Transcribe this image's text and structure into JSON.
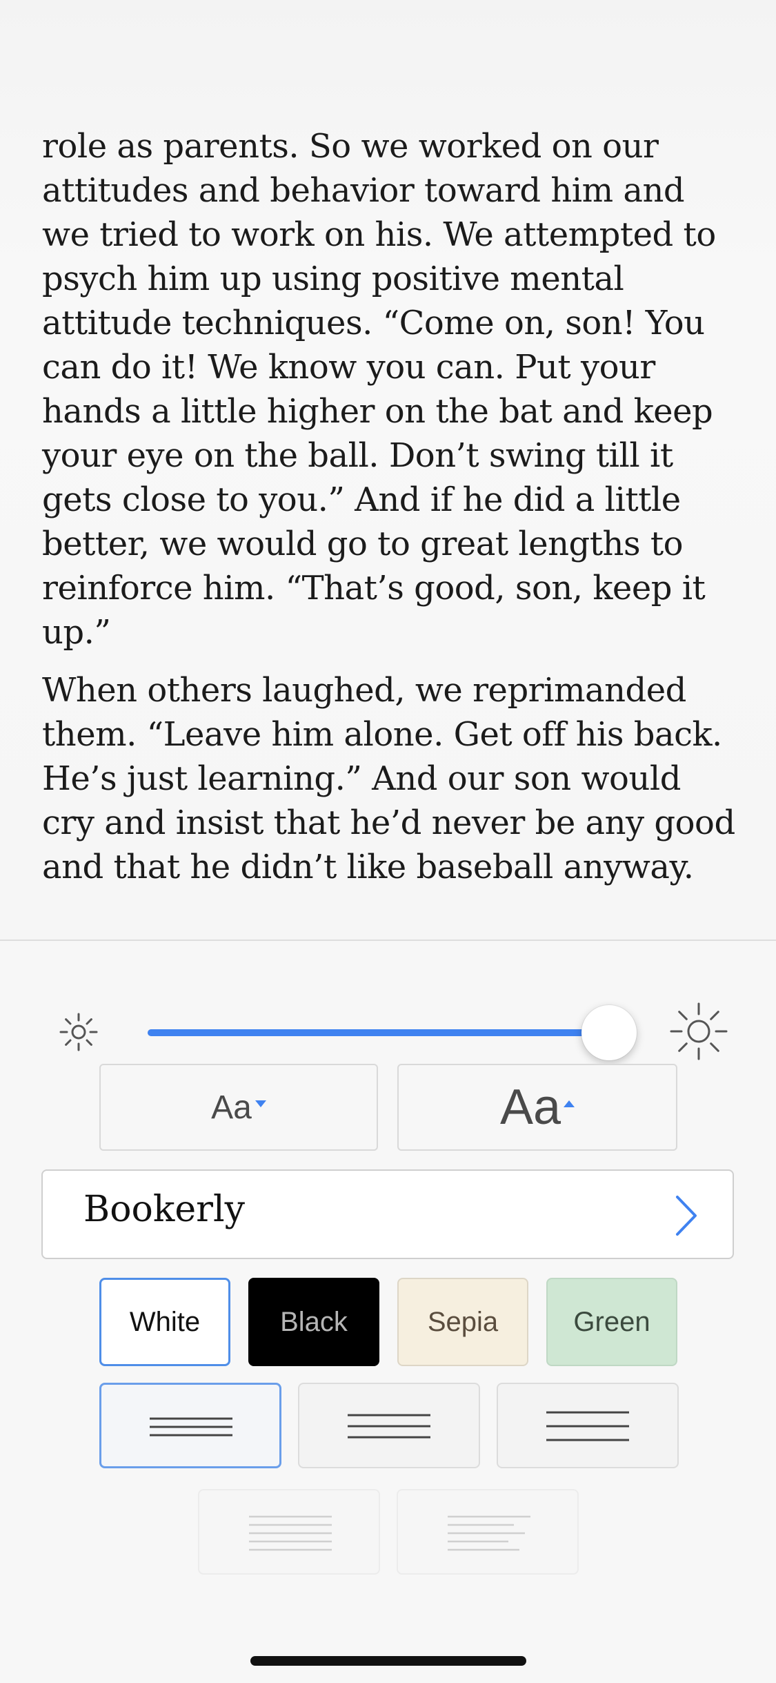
{
  "reader": {
    "paragraphs": [
      "role as parents. So we worked on our attitudes and behavior toward him and we tried to work on his. We attempted to psych him up using positive mental attitude techniques. “Come on, son! You can do it! We know you can. Put your hands a little higher on the bat and keep your eye on the ball. Don’t swing till it gets close to you.” And if he did a little better, we would go to great lengths to reinforce him. “That’s good, son, keep it up.”",
      "When others laughed, we reprimanded them. “Leave him alone. Get off his back. He’s just learning.” And our son would cry and insist that he’d never be any good and that he didn’t like baseball anyway."
    ]
  },
  "settings": {
    "brightness": {
      "level_percent": 97,
      "low_icon": "sun-small-icon",
      "high_icon": "sun-large-icon",
      "accent_color": "#3f82f0"
    },
    "font_size": {
      "decrease_label": "Aa",
      "increase_label": "Aa"
    },
    "font": {
      "name": "Bookerly",
      "chevron_icon": "chevron-right-icon"
    },
    "themes": [
      {
        "label": "White",
        "selected": true,
        "background": "#ffffff"
      },
      {
        "label": "Black",
        "selected": false,
        "background": "#000000"
      },
      {
        "label": "Sepia",
        "selected": false,
        "background": "#f6efdf"
      },
      {
        "label": "Green",
        "selected": false,
        "background": "#cfe7d3"
      }
    ],
    "line_spacing": [
      {
        "name": "narrow",
        "selected": true
      },
      {
        "name": "medium",
        "selected": false
      },
      {
        "name": "wide",
        "selected": false
      }
    ],
    "alignment": [
      {
        "name": "justify",
        "enabled": false
      },
      {
        "name": "left",
        "enabled": false
      }
    ]
  }
}
